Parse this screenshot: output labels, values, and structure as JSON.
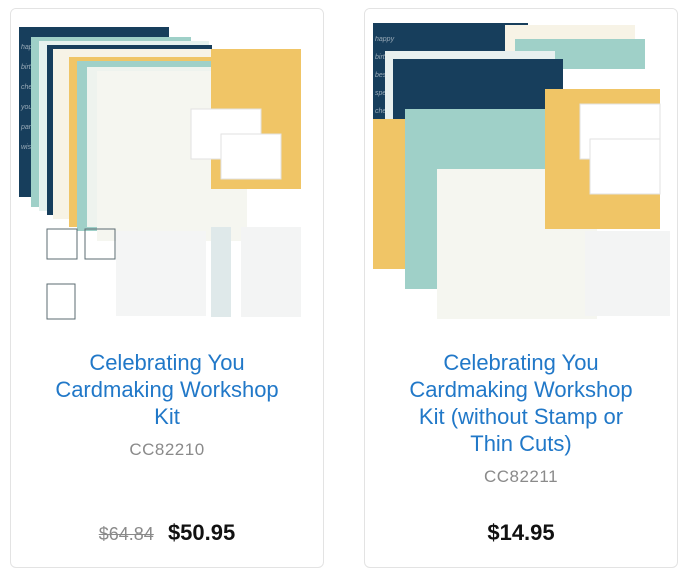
{
  "products": [
    {
      "title_lines": [
        "Celebrating You",
        "Cardmaking Workshop",
        "Kit"
      ],
      "sku": "CC82210",
      "original_price": "$64.84",
      "price": "$50.95",
      "image_alt": "Cardmaking kit papers, stamps and thin cuts"
    },
    {
      "title_lines": [
        "Celebrating You",
        "Cardmaking Workshop",
        "Kit (without Stamp or",
        "Thin Cuts)"
      ],
      "sku": "CC82211",
      "original_price": "",
      "price": "$14.95",
      "image_alt": "Cardmaking kit papers and cards"
    }
  ],
  "colors": {
    "link_blue": "#2178c8",
    "navy": "#173e5c",
    "teal": "#9fd0c8",
    "mustard": "#f0c566",
    "cream": "#f7f3e6"
  }
}
